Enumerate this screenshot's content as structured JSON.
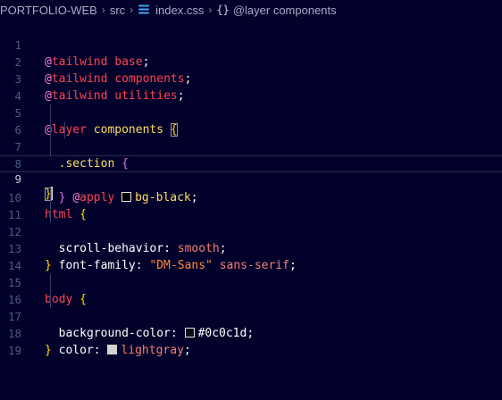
{
  "breadcrumb": {
    "project": "PORTFOLIO-WEB",
    "folder": "src",
    "file": "index.css",
    "symbol_icon": "{}",
    "symbol": "@layer components",
    "file_icon": "css-file-icon"
  },
  "editor": {
    "language": "css",
    "active_line": 9,
    "lines": [
      {
        "n": "1",
        "tokens": {
          "at": "@",
          "kw": "tailwind",
          "sp": " ",
          "name": "base",
          "end": ";"
        }
      },
      {
        "n": "2",
        "tokens": {
          "at": "@",
          "kw": "tailwind",
          "sp": " ",
          "name": "components",
          "end": ";"
        }
      },
      {
        "n": "3",
        "tokens": {
          "at": "@",
          "kw": "tailwind",
          "sp": " ",
          "name": "utilities",
          "end": ";"
        }
      },
      {
        "n": "4",
        "text": ""
      },
      {
        "n": "5",
        "tokens": {
          "at": "@",
          "kw": "layer",
          "sp": " ",
          "name": "components",
          "sp2": " ",
          "brace": "{"
        }
      },
      {
        "n": "6",
        "tokens": {
          "indent": "  ",
          "sel": ".section",
          "sp": " ",
          "brace": "{"
        }
      },
      {
        "n": "7",
        "tokens": {
          "indent": "    ",
          "at": "@",
          "kw": "apply",
          "sp": " ",
          "cls": "bg-black",
          "end": ";"
        }
      },
      {
        "n": "8",
        "tokens": {
          "indent": "  ",
          "brace": "}"
        }
      },
      {
        "n": "9",
        "tokens": {
          "brace": "}"
        }
      },
      {
        "n": "10",
        "tokens": {
          "sel": "html",
          "sp": " ",
          "brace": "{"
        }
      },
      {
        "n": "11",
        "tokens": {
          "indent": "  ",
          "prop": "scroll-behavior",
          "colon": ": ",
          "val": "smooth",
          "end": ";"
        }
      },
      {
        "n": "12",
        "tokens": {
          "indent": "  ",
          "prop": "font-family",
          "colon": ": ",
          "str": "\"DM-Sans\"",
          "sp": " ",
          "val": "sans-serif",
          "end": ";"
        }
      },
      {
        "n": "13",
        "tokens": {
          "brace": "}"
        }
      },
      {
        "n": "14",
        "text": ""
      },
      {
        "n": "15",
        "tokens": {
          "sel": "body",
          "sp": " ",
          "brace": "{"
        }
      },
      {
        "n": "16",
        "tokens": {
          "indent": "  ",
          "prop": "background-color",
          "colon": ": ",
          "val": "#0c0c1d",
          "end": ";"
        }
      },
      {
        "n": "17",
        "tokens": {
          "indent": "  ",
          "prop": "color",
          "colon": ": ",
          "val": "lightgray",
          "end": ";"
        }
      },
      {
        "n": "18",
        "tokens": {
          "brace": "}"
        }
      },
      {
        "n": "19",
        "text": ""
      }
    ]
  },
  "colors": {
    "background": "#01012b",
    "swatch_bg_black": "#000000",
    "swatch_bg_color": "#0c0c1d",
    "swatch_lightgray": "#d3d3d3"
  }
}
